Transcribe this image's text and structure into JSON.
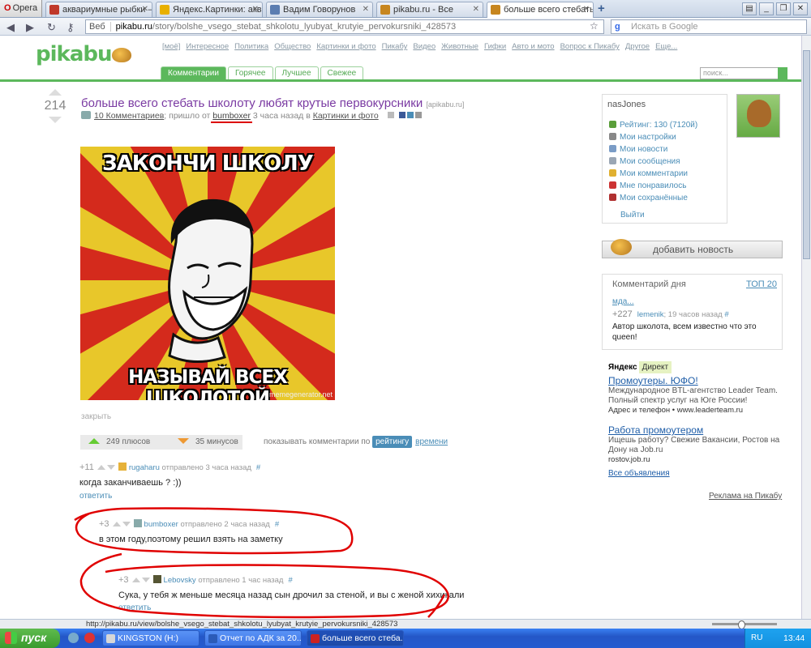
{
  "browser": {
    "menu_label": "Opera",
    "tabs": [
      {
        "label": "аквариумные рыбки — ...",
        "color": "#c0392b"
      },
      {
        "label": "Яндекс.Картинки: акв...",
        "color": "#e8b000"
      },
      {
        "label": "Вадим Говорунов",
        "color": "#5b7db1"
      },
      {
        "label": "pikabu.ru - Все",
        "color": "#c7861f"
      },
      {
        "label": "больше всего стебать ...",
        "color": "#c7861f",
        "active": true
      }
    ],
    "address_prefix": "Веб",
    "url_host": "pikabu.ru",
    "url_path": "/story/bolshe_vsego_stebat_shkolotu_lyubyat_krutyie_pervokursniki_428573",
    "search_placeholder": "Искать в Google",
    "status_url": "http://pikabu.ru/view/bolshe_vsego_stebat_shkolotu_lyubyat_krutyie_pervokursniki_428573",
    "zoom_label": ""
  },
  "site": {
    "logo": "pikabu",
    "topnav": [
      "[моё]",
      "Интересное",
      "Политика",
      "Общество",
      "Картинки и фото",
      "Пикабу",
      "Видео",
      "Животные",
      "Гифки",
      "Авто и мото",
      "Вопрос к Пикабу",
      "Другое",
      "Еще..."
    ],
    "tabs": [
      "Комментарии",
      "Горячее",
      "Лучшее",
      "Свежее"
    ],
    "search_placeholder": "поиск..."
  },
  "story": {
    "score": "214",
    "title": "больше всего стебать школоту любят крутые первокурсники",
    "source": "[apikabu.ru]",
    "comments_link": "10 Комментариев",
    "posted_from": "; пришло от",
    "author": "bumboxer",
    "posted_when": "3 часа назад в",
    "category": "Картинки и фото",
    "meme_top": "ЗАКОНЧИ ШКОЛУ",
    "meme_bottom": "НАЗЫВАЙ ВСЕХ ШКОЛОТОЙ",
    "meme_watermark": "memegenerator.net",
    "close_label": "закрыть",
    "pluses": "249 плюсов",
    "minuses": "35 минусов",
    "sort_label": "показывать комментарии по",
    "sort_rating": "рейтингу",
    "sort_time": "времени"
  },
  "comments": [
    {
      "score": "+11",
      "author": "rugaharu",
      "when": "отправлено 3 часа назад",
      "hash": "#",
      "text": "когда заканчиваешь ? :))",
      "reply": "ответить"
    },
    {
      "score": "+3",
      "author": "bumboxer",
      "when": "отправлено 2 часа назад",
      "hash": "#",
      "text": "в этом году,поэтому решил взять на заметку",
      "reply": ""
    },
    {
      "score": "+3",
      "author": "Lebovsky",
      "when": "отправлено 1 час назад",
      "hash": "#",
      "text": "Сука, у тебя ж меньше месяца назад сын дрочил за стеной, и вы с женой хихикали",
      "reply": "ответить"
    }
  ],
  "sidebar": {
    "username": "nasJones",
    "menu": [
      {
        "label": "Рейтинг: 130 (7120й)",
        "color": "#5a9e3a"
      },
      {
        "label": "Мои настройки",
        "color": "#888888"
      },
      {
        "label": "Мои новости",
        "color": "#7a9cc6"
      },
      {
        "label": "Мои сообщения",
        "color": "#9aa6b4"
      },
      {
        "label": "Мои комментарии",
        "color": "#e0b030"
      },
      {
        "label": "Мне понравилось",
        "color": "#cc3333"
      },
      {
        "label": "Мои сохранённые",
        "color": "#b03030"
      }
    ],
    "logout": "Выйти",
    "add_news": "добавить новость",
    "cod_title": "Комментарий дня",
    "cod_top": "ТОП 20",
    "cod_link": "мда...",
    "cod_score": "+227",
    "cod_author": "lemenik",
    "cod_when": "; 19 часов назад",
    "cod_hash": "#",
    "cod_text": "Автор школота, всем известно что это queen!"
  },
  "ads": {
    "yandex": "Яндекс",
    "direct": "Директ",
    "items": [
      {
        "title": "Промоутеры. ЮФО!",
        "desc": "Международное BTL-агентство Leader Team. Полный спектр услуг на Юге России!",
        "link": "Адрес и телефон • www.leaderteam.ru"
      },
      {
        "title": "Работа промоутером",
        "desc": "Ищешь работу? Свежие Вакансии, Ростов на Дону на Job.ru",
        "link": "rostov.job.ru"
      }
    ],
    "all": "Все объявления",
    "footer": "Реклама на Пикабу"
  },
  "taskbar": {
    "start": "пуск",
    "tasks": [
      {
        "label": "KINGSTON (H:)",
        "color": "#d7d7d7"
      },
      {
        "label": "Отчет по АДК за 20...",
        "color": "#2b5bb8"
      },
      {
        "label": "больше всего стеба...",
        "color": "#cc2222",
        "active": true
      }
    ],
    "lang": "RU",
    "clock": "13:44"
  }
}
